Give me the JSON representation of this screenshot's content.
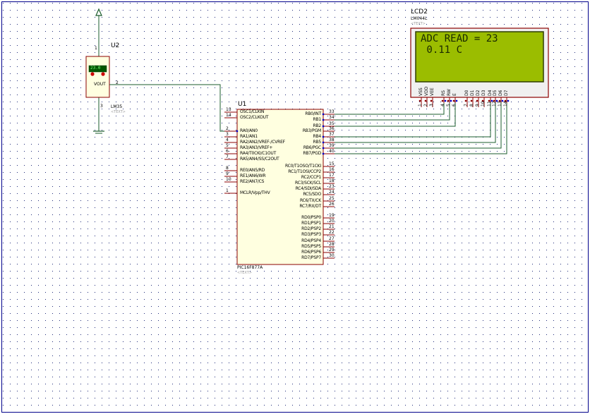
{
  "colors": {
    "background": "#ffffff",
    "grid_dot": "#1f2a7a",
    "border": "#00008b",
    "wire": "#1b5c2c",
    "chip_fill": "#ffffe0",
    "chip_stroke": "#8b0000",
    "lcd_screen": "#9bbd00",
    "lcd_frame_fill": "#f0f0f0",
    "pin_dot_red": "#b00000",
    "pin_dot_blue": "#0000cc"
  },
  "u2": {
    "id": "U2",
    "value": "LM35",
    "text_tag": "<TEXT>",
    "display": "23.0",
    "vout_label": "VOUT",
    "pin1": "1",
    "pin2": "2",
    "pin3": "3"
  },
  "u1": {
    "id": "U1",
    "value": "PIC16F877A",
    "text_tag": "<TEXT>",
    "left_pins": [
      {
        "num": "13",
        "name": "OSC1/CLKIN"
      },
      {
        "num": "14",
        "name": "OSC2/CLKOUT"
      },
      {
        "num": "2",
        "name": "RA0/AN0"
      },
      {
        "num": "3",
        "name": "RA1/AN1"
      },
      {
        "num": "4",
        "name": "RA2/AN2/VREF-/CVREF"
      },
      {
        "num": "5",
        "name": "RA3/AN3/VREF+"
      },
      {
        "num": "6",
        "name": "RA4/T0CKI/C1OUT"
      },
      {
        "num": "7",
        "name": "RA5/AN4/SS/C2OUT"
      },
      {
        "num": "8",
        "name": "RE0/AN5/RD"
      },
      {
        "num": "9",
        "name": "RE1/AN6/WR"
      },
      {
        "num": "10",
        "name": "RE2/AN7/CS"
      },
      {
        "num": "1",
        "name": "MCLR/Vpp/THV"
      }
    ],
    "right_pins_b": [
      {
        "num": "33",
        "name": "RB0/INT"
      },
      {
        "num": "34",
        "name": "RB1"
      },
      {
        "num": "35",
        "name": "RB2"
      },
      {
        "num": "36",
        "name": "RB3/PGM"
      },
      {
        "num": "37",
        "name": "RB4"
      },
      {
        "num": "38",
        "name": "RB5"
      },
      {
        "num": "39",
        "name": "RB6/PGC"
      },
      {
        "num": "40",
        "name": "RB7/PGD"
      }
    ],
    "right_pins_c": [
      {
        "num": "15",
        "name": "RC0/T1OSO/T1CKI"
      },
      {
        "num": "16",
        "name": "RC1/T1OSI/CCP2"
      },
      {
        "num": "17",
        "name": "RC2/CCP1"
      },
      {
        "num": "18",
        "name": "RC3/SCK/SCL"
      },
      {
        "num": "23",
        "name": "RC4/SDI/SDA"
      },
      {
        "num": "24",
        "name": "RC5/SDO"
      },
      {
        "num": "25",
        "name": "RC6/TX/CK"
      },
      {
        "num": "26",
        "name": "RC7/RX/DT"
      }
    ],
    "right_pins_d": [
      {
        "num": "19",
        "name": "RD0/PSP0"
      },
      {
        "num": "20",
        "name": "RD1/PSP1"
      },
      {
        "num": "21",
        "name": "RD2/PSP2"
      },
      {
        "num": "22",
        "name": "RD3/PSP3"
      },
      {
        "num": "27",
        "name": "RD4/PSP4"
      },
      {
        "num": "28",
        "name": "RD5/PSP5"
      },
      {
        "num": "29",
        "name": "RD6/PSP6"
      },
      {
        "num": "30",
        "name": "RD7/PSP7"
      }
    ]
  },
  "lcd2": {
    "id": "LCD2",
    "value": "LM044L",
    "text_tag": "<TEXT>",
    "line1": "ADC READ = 23",
    "line2": " 0.11 C",
    "pins": [
      {
        "name": "VSS",
        "num": "1"
      },
      {
        "name": "VDD",
        "num": "2"
      },
      {
        "name": "VEE",
        "num": "3"
      },
      {
        "name": "RS",
        "num": "4"
      },
      {
        "name": "RW",
        "num": "5"
      },
      {
        "name": "E",
        "num": "6"
      },
      {
        "name": "D0",
        "num": "7"
      },
      {
        "name": "D1",
        "num": "8"
      },
      {
        "name": "D2",
        "num": "9"
      },
      {
        "name": "D3",
        "num": "10"
      },
      {
        "name": "D4",
        "num": "11"
      },
      {
        "name": "D5",
        "num": "12"
      },
      {
        "name": "D6",
        "num": "13"
      },
      {
        "name": "D7",
        "num": "14"
      }
    ]
  }
}
